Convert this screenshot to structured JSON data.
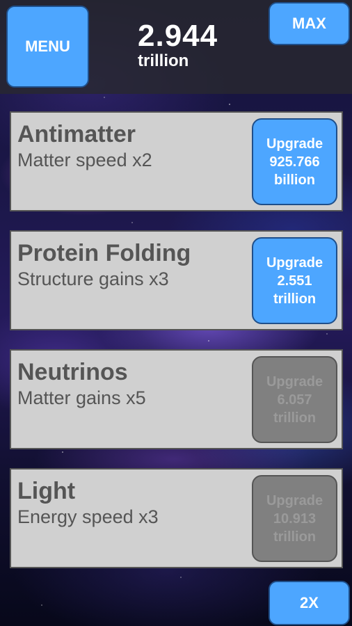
{
  "header": {
    "menu_label": "MENU",
    "max_label": "MAX",
    "currency_value": "2.944",
    "currency_unit": "trillion"
  },
  "upgrades": [
    {
      "title": "Antimatter",
      "description": "Matter speed x2",
      "button_line1": "Upgrade",
      "button_line2": "925.766",
      "button_line3": "billion",
      "enabled": true
    },
    {
      "title": "Protein Folding",
      "description": "Structure gains x3",
      "button_line1": "Upgrade",
      "button_line2": "2.551",
      "button_line3": "trillion",
      "enabled": true
    },
    {
      "title": "Neutrinos",
      "description": "Matter gains x5",
      "button_line1": "Upgrade",
      "button_line2": "6.057",
      "button_line3": "trillion",
      "enabled": false
    },
    {
      "title": "Light",
      "description": "Energy speed x3",
      "button_line1": "Upgrade",
      "button_line2": "10.913",
      "button_line3": "trillion",
      "enabled": false
    }
  ],
  "footer": {
    "multiplier_label": "2X"
  },
  "colors": {
    "button_blue": "#4da6ff",
    "button_disabled": "#808080",
    "card_background": "#d0d0d0",
    "card_text": "#555555"
  }
}
